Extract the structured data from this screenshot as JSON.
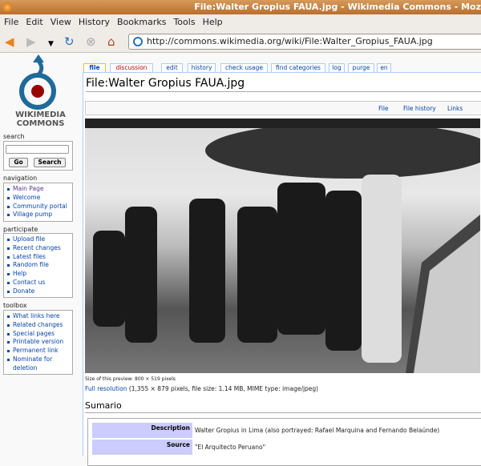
{
  "window": {
    "title": "File:Walter Gropius FAUA.jpg - Wikimedia Commons - Moz"
  },
  "menu": [
    "File",
    "Edit",
    "View",
    "History",
    "Bookmarks",
    "Tools",
    "Help"
  ],
  "url": "http://commons.wikimedia.org/wiki/File:Walter_Gropius_FAUA.jpg",
  "logo": {
    "line1": "WIKIMEDIA",
    "line2": "COMMONS"
  },
  "search": {
    "label": "search",
    "go": "Go",
    "search": "Search",
    "value": ""
  },
  "navigation": {
    "label": "navigation",
    "items": [
      "Main Page",
      "Welcome",
      "Community portal",
      "Village pump"
    ]
  },
  "participate": {
    "label": "participate",
    "items": [
      "Upload file",
      "Recent changes",
      "Latest files",
      "Random file",
      "Help",
      "Contact us",
      "Donate"
    ]
  },
  "toolbox": {
    "label": "toolbox",
    "items": [
      "What links here",
      "Related changes",
      "Special pages",
      "Printable version",
      "Permanent link",
      "Nominate for deletion"
    ]
  },
  "tabs": [
    "file",
    "discussion",
    "edit",
    "history",
    "check usage",
    "find categories",
    "log",
    "purge",
    "en"
  ],
  "page": {
    "title": "File:Walter Gropius FAUA.jpg",
    "file_links": [
      "File",
      "File history",
      "Links"
    ],
    "preview_size": "Size of this preview: 800 × 519 pixels",
    "full_res_link": "Full resolution",
    "full_res_info": " (1,355 × 879 pixels, file size: 1.14 MB, MIME type: image/jpeg)",
    "section": "Sumario",
    "rows": [
      {
        "label": "Description",
        "value": "Walter Gropius in Lima (also portrayed: Rafael Marquina and Fernando Belaúnde)"
      },
      {
        "label": "Source",
        "value": "\"El Arquitecto Peruano\""
      }
    ]
  },
  "colors": {
    "link": "#0645ad",
    "tab_active": "#ffffff",
    "table_header": "#ccccff",
    "logo_blue": "#1f6a99",
    "logo_red": "#990000"
  }
}
